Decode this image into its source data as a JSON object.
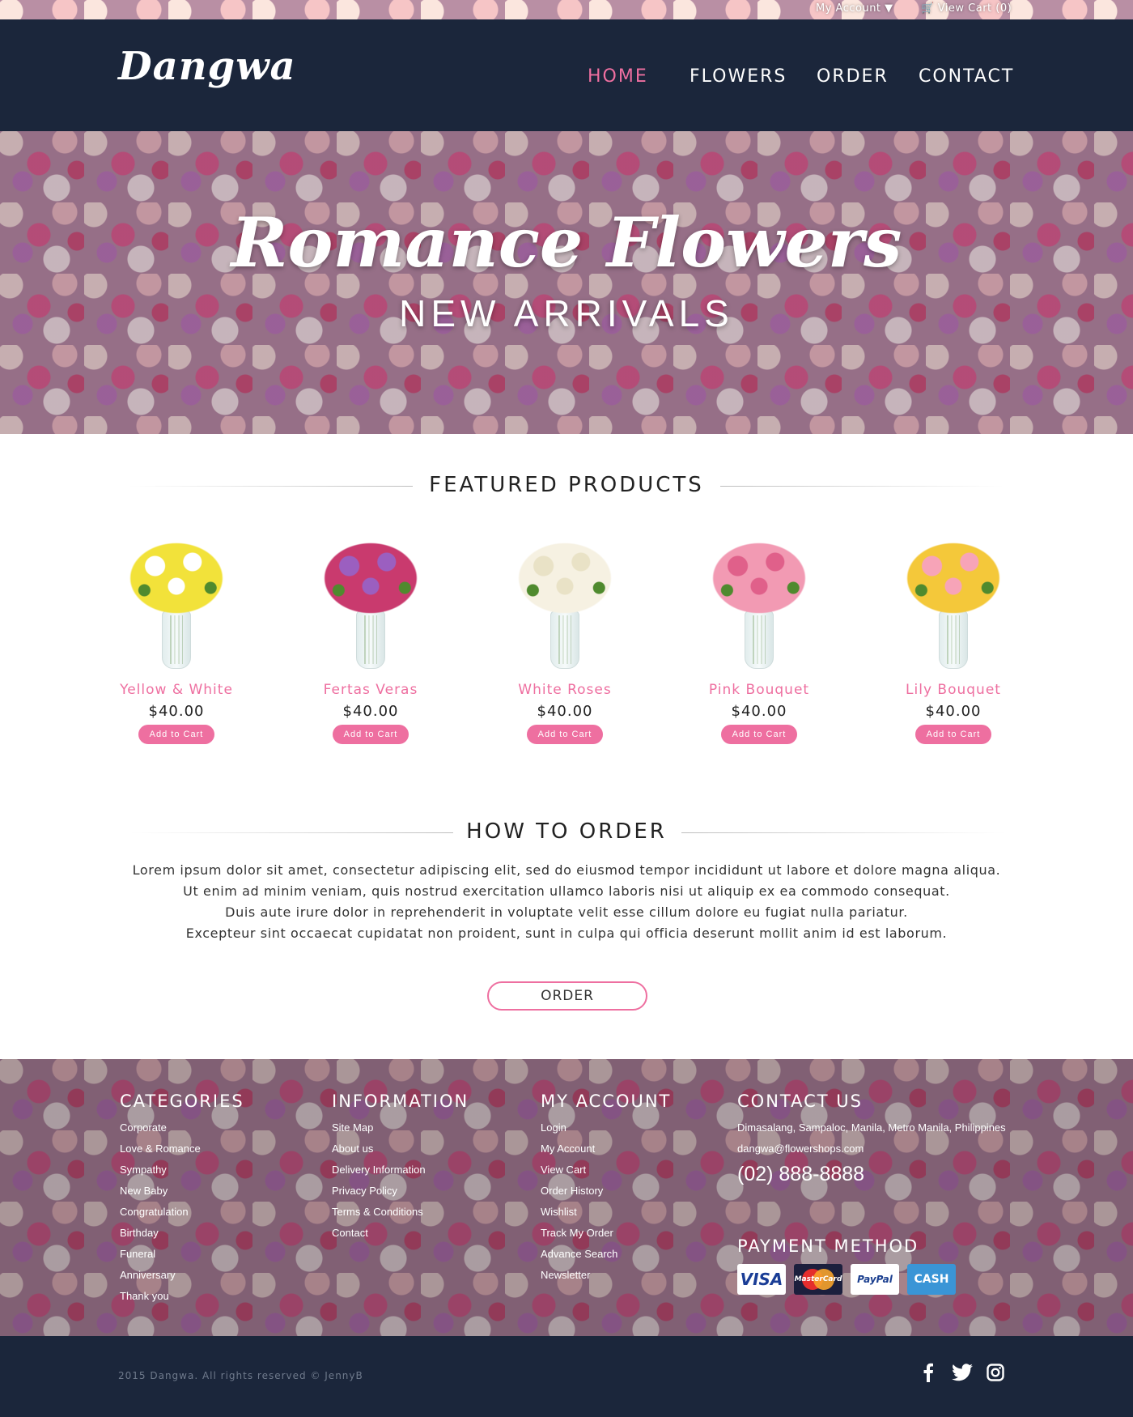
{
  "topbar": {
    "account_label": "My Account ▼",
    "cart_label": "View Cart (0)"
  },
  "header": {
    "logo": "Dangwa",
    "nav": [
      {
        "label": "HOME",
        "active": true
      },
      {
        "label": "FLOWERS",
        "active": false
      },
      {
        "label": "ORDER",
        "active": false
      },
      {
        "label": "CONTACT",
        "active": false
      }
    ]
  },
  "hero": {
    "title": "Romance Flowers",
    "subtitle": "NEW ARRIVALS"
  },
  "featured": {
    "title": "FEATURED PRODUCTS",
    "products": [
      {
        "name": "Yellow & White",
        "price": "$40.00",
        "button": "Add to Cart",
        "bloom_color": "#f2e23a",
        "accent_color": "#ffffff"
      },
      {
        "name": "Fertas Veras",
        "price": "$40.00",
        "button": "Add to Cart",
        "bloom_color": "#c93a6e",
        "accent_color": "#9b5fc0"
      },
      {
        "name": "White Roses",
        "price": "$40.00",
        "button": "Add to Cart",
        "bloom_color": "#f6f1e2",
        "accent_color": "#e9e2c6"
      },
      {
        "name": "Pink Bouquet",
        "price": "$40.00",
        "button": "Add to Cart",
        "bloom_color": "#f29ab3",
        "accent_color": "#e0608a"
      },
      {
        "name": "Lily Bouquet",
        "price": "$40.00",
        "button": "Add to Cart",
        "bloom_color": "#f4c83a",
        "accent_color": "#f7a4b8"
      }
    ]
  },
  "how_to_order": {
    "title": "HOW TO ORDER",
    "lines": [
      "Lorem ipsum dolor sit amet, consectetur adipiscing elit, sed do eiusmod tempor incididunt ut labore et dolore magna aliqua.",
      "Ut enim ad minim veniam, quis nostrud exercitation ullamco laboris nisi ut aliquip ex ea commodo consequat.",
      "Duis aute irure dolor in reprehenderit in voluptate velit esse cillum dolore eu fugiat nulla pariatur.",
      "Excepteur sint occaecat cupidatat non proident, sunt in culpa qui officia deserunt mollit anim id est laborum."
    ],
    "button": "ORDER"
  },
  "footer": {
    "categories": {
      "title": "CATEGORIES",
      "items": [
        "Corporate",
        "Love & Romance",
        "Sympathy",
        "New Baby",
        "Congratulation",
        "Birthday",
        "Funeral",
        "Anniversary",
        "Thank you"
      ]
    },
    "information": {
      "title": "INFORMATION",
      "items": [
        "Site Map",
        "About us",
        "Delivery Information",
        "Privacy Policy",
        "Terms & Conditions",
        "Contact"
      ]
    },
    "my_account": {
      "title": "MY ACCOUNT",
      "items": [
        "Login",
        "My Account",
        "View Cart",
        "Order History",
        "Wishlist",
        "Track My Order",
        "Advance Search",
        "Newsletter"
      ]
    },
    "contact": {
      "title": "CONTACT US",
      "address": "Dimasalang, Sampaloc, Manila, Metro Manila, Philippines",
      "email": "dangwa@flowershops.com",
      "phone": "(02) 888-8888"
    },
    "payment": {
      "title": "PAYMENT METHOD",
      "cards": [
        {
          "icon": "visa-card-icon",
          "label": "VISA"
        },
        {
          "icon": "mastercard-icon",
          "label": "MasterCard"
        },
        {
          "icon": "paypal-icon",
          "label": "PayPal"
        },
        {
          "icon": "cash-icon",
          "label": "CASH"
        }
      ]
    }
  },
  "bottom": {
    "copyright": "2015  Dangwa. All rights reserved © JennyB",
    "social": [
      "facebook-icon",
      "twitter-icon",
      "instagram-icon"
    ]
  },
  "colors": {
    "navy": "#1b263b",
    "pink": "#ee6fa0"
  }
}
